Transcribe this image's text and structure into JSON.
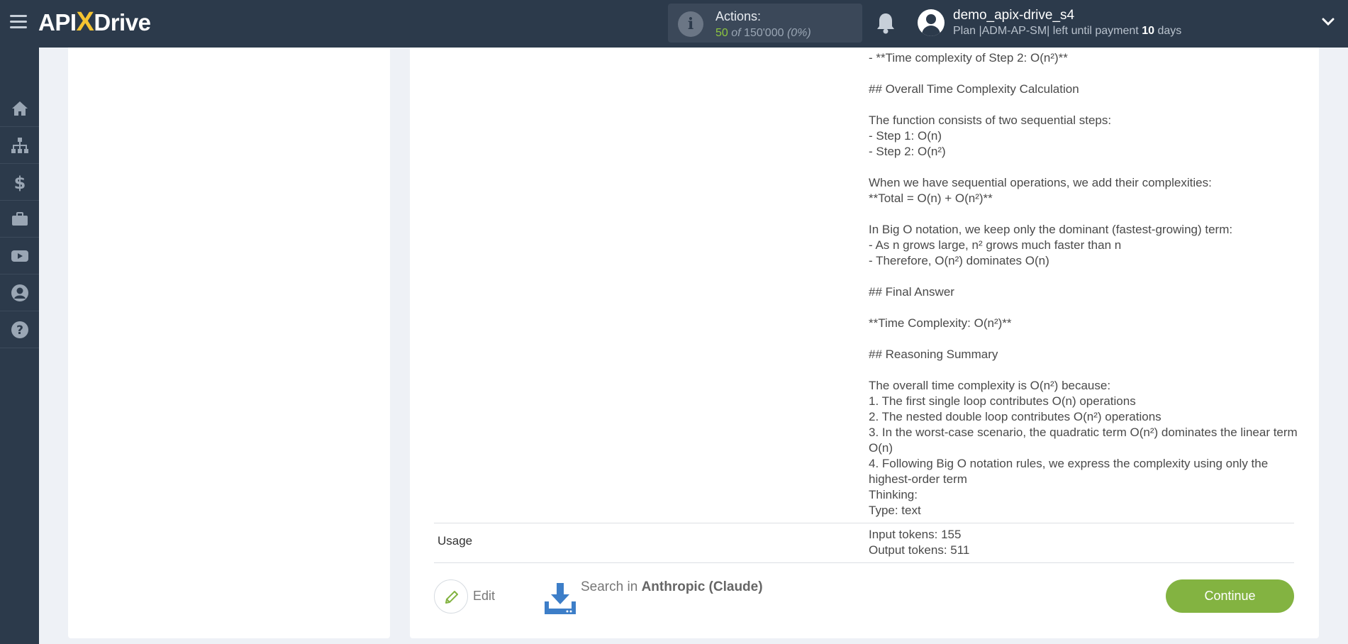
{
  "header": {
    "logo_api": "API",
    "logo_x": "X",
    "logo_drive": "Drive",
    "actions_label": "Actions:",
    "actions_used": "50",
    "actions_of": "of",
    "actions_total": "150'000",
    "actions_pct": "(0%)",
    "user_name": "demo_apix-drive_s4",
    "plan_prefix": "Plan |ADM-AP-SM| left until payment",
    "plan_days": "10",
    "plan_suffix": "days"
  },
  "sidebar": {
    "items": [
      {
        "icon": "home-icon"
      },
      {
        "icon": "sitemap-icon"
      },
      {
        "icon": "dollar-icon"
      },
      {
        "icon": "briefcase-icon"
      },
      {
        "icon": "youtube-icon"
      },
      {
        "icon": "user-icon"
      },
      {
        "icon": "help-icon"
      }
    ]
  },
  "result": {
    "lines": [
      "- **Time complexity of Step 2: O(n²)**",
      "",
      "## Overall Time Complexity Calculation",
      "",
      "The function consists of two sequential steps:",
      "- Step 1: O(n)",
      "- Step 2: O(n²)",
      "",
      "When we have sequential operations, we add their complexities:",
      "**Total = O(n) + O(n²)**",
      "",
      "In Big O notation, we keep only the dominant (fastest-growing) term:",
      "- As n grows large, n² grows much faster than n",
      "- Therefore, O(n²) dominates O(n)",
      "",
      "## Final Answer",
      "",
      "**Time Complexity: O(n²)**",
      "",
      "## Reasoning Summary",
      "",
      "The overall time complexity is O(n²) because:",
      "1. The first single loop contributes O(n) operations",
      "2. The nested double loop contributes O(n²) operations",
      "3. In the worst-case scenario, the quadratic term O(n²) dominates the linear term O(n)",
      "4. Following Big O notation rules, we express the complexity using only the highest-order term",
      "Thinking:",
      "Type: text"
    ],
    "usage_label": "Usage",
    "input_tokens": "Input tokens: 155",
    "output_tokens": "Output tokens: 511"
  },
  "footer": {
    "edit_label": "Edit",
    "search_prefix": "Search in",
    "search_service": "Anthropic (Claude)",
    "continue_label": "Continue"
  },
  "colors": {
    "topbar": "#2c3a4b",
    "accent_green": "#83b341",
    "logo_x": "#f5c431",
    "download_blue": "#3d7ec8"
  }
}
